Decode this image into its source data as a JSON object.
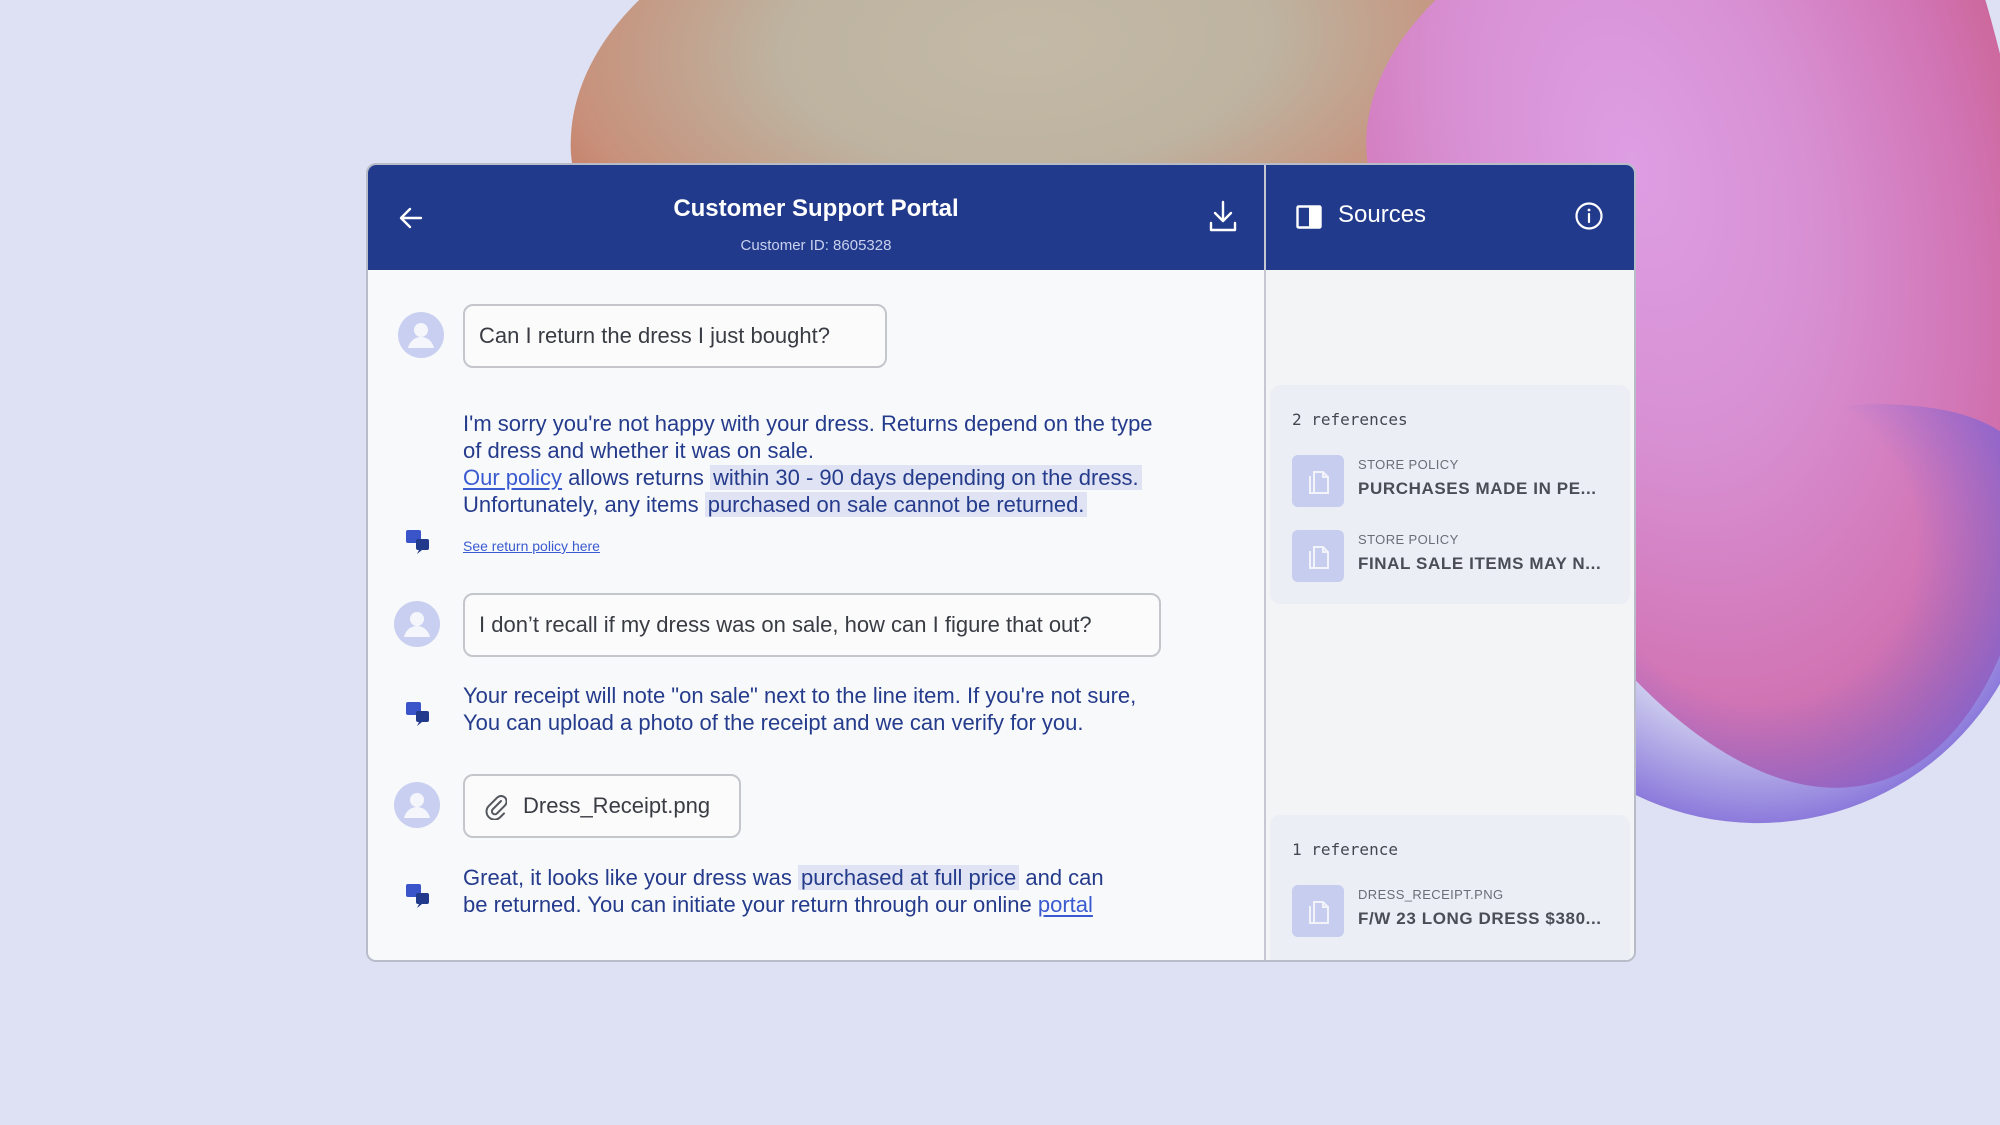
{
  "header": {
    "title": "Customer Support Portal",
    "customer_id": "Customer ID: 8605328"
  },
  "sources": {
    "title": "Sources",
    "groups": [
      {
        "count_label": "2 references",
        "items": [
          {
            "label": "STORE POLICY",
            "title": "PURCHASES MADE IN PE..."
          },
          {
            "label": "STORE POLICY",
            "title": "FINAL SALE ITEMS MAY N..."
          }
        ]
      },
      {
        "count_label": "1 reference",
        "items": [
          {
            "label": "DRESS_RECEIPT.PNG",
            "title": "F/W 23 LONG DRESS $380..."
          }
        ]
      }
    ]
  },
  "messages": {
    "user1": "Can I return the dress I just bought?",
    "bot1": {
      "line1": "I'm sorry you're not happy with your dress. Returns depend on the type",
      "line2": "of dress and whether it was on sale.",
      "link": "Our policy",
      "l3_mid": " allows returns ",
      "hl1": "within 30 - 90 days depending on the dress.",
      "l4_pre": "Unfortunately, any items ",
      "hl2": "purchased on sale cannot be returned.",
      "small_link": "See return policy here"
    },
    "user2": "I don’t recall if my dress was on sale, how can I figure that out?",
    "bot2": {
      "line1": "Your receipt will note \"on sale\" next to the line item. If you're not sure,",
      "line2": "You can upload a photo of the receipt and we can verify for you."
    },
    "user3_attachment": "Dress_Receipt.png",
    "bot3": {
      "l1_pre": "Great, it looks like your dress was ",
      "hl": "purchased at full price",
      "l1_post": " and can",
      "l2_pre": "be returned. You can initiate your return through our online ",
      "link": "portal"
    }
  },
  "icons": {
    "back": "arrow-left-icon",
    "download": "download-icon",
    "panel": "panel-toggle-icon",
    "info": "info-icon",
    "avatar": "user-avatar-icon",
    "bot": "chat-bubbles-icon",
    "attachment": "paperclip-icon",
    "document": "document-icon"
  },
  "colors": {
    "header": "#223a8c",
    "bot_text": "#253b8c",
    "link": "#3a5bd0",
    "highlight": "#dfe3f3"
  }
}
